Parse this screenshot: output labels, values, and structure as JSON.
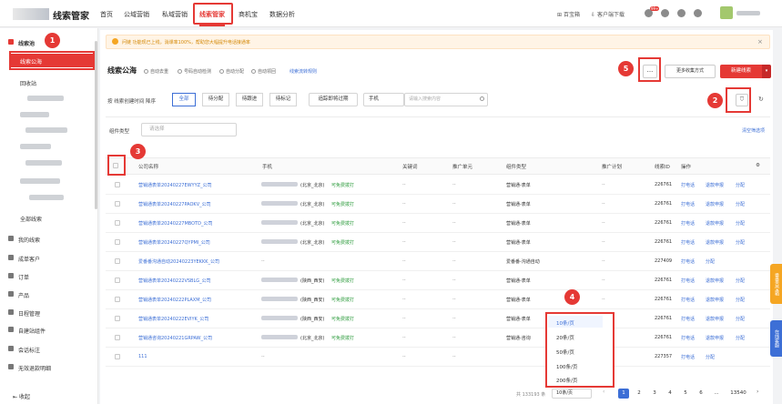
{
  "topnav": {
    "brand": "线索管家",
    "items": [
      "首页",
      "公域营销",
      "私域营销",
      "线索管家",
      "商机宝",
      "数据分析"
    ],
    "tools": [
      "百宝箱",
      "客户端下载"
    ],
    "badge": "99+"
  },
  "sidebar": {
    "group": "线索池",
    "active": "线索公海",
    "items": [
      "回收站",
      "全部线索",
      "我的线索",
      "成单客户",
      "订单",
      "产品",
      "日程管理",
      "自建站组件",
      "会话标注",
      "无效退款明细"
    ],
    "collapse": "收起"
  },
  "markers": [
    "1",
    "2",
    "3",
    "4",
    "5"
  ],
  "banner": {
    "text": "问链 功能现已上线，消课率100%，帮助您大幅提升电话接通率"
  },
  "page": {
    "title": "线索公海",
    "toggles": [
      "自动去重",
      "号码自动检测",
      "自动分配",
      "自动领回"
    ],
    "rule_link": "线索流转规则",
    "more": "...",
    "collect": "更多收集方式",
    "new": "新建线索"
  },
  "filters": {
    "sort_label": "按 线索创建时间 降序",
    "tabs": [
      "全部",
      "待分配",
      "待跟进",
      "待标记"
    ],
    "today": "追踪即将过期",
    "phone": "手机",
    "search_placeholder": "请输入搜索内容",
    "comp_label": "组件类型",
    "comp_placeholder": "请选择",
    "clear": "清空筛选项"
  },
  "table": {
    "headers": [
      "公司名称",
      "手机",
      "关键词",
      "推广单元",
      "组件类型",
      "推广计划",
      "线索ID",
      "操作"
    ],
    "rows": [
      {
        "company": "营销通表单20240227EWYYZ_公司",
        "region": "(北京_北京)",
        "status": "可免费拨打",
        "kw": "--",
        "unit": "--",
        "type": "营销通-表单",
        "plan": "--",
        "id": "226761",
        "ops": [
          "打电话",
          "退款申报",
          "分配"
        ]
      },
      {
        "company": "营销通表单20240227PAOKV_公司",
        "region": "(北京_北京)",
        "status": "可免费拨打",
        "kw": "--",
        "unit": "--",
        "type": "营销通-表单",
        "plan": "--",
        "id": "226761",
        "ops": [
          "打电话",
          "退款申报",
          "分配"
        ]
      },
      {
        "company": "营销通表单20240227MBOTD_公司",
        "region": "(北京_北京)",
        "status": "可免费拨打",
        "kw": "--",
        "unit": "--",
        "type": "营销通-表单",
        "plan": "--",
        "id": "226761",
        "ops": [
          "打电话",
          "退款申报",
          "分配"
        ]
      },
      {
        "company": "营销通表单20240227QYPMI_公司",
        "region": "(北京_北京)",
        "status": "可免费拨打",
        "kw": "--",
        "unit": "--",
        "type": "营销通-表单",
        "plan": "--",
        "id": "226761",
        "ops": [
          "打电话",
          "退款申报",
          "分配"
        ]
      },
      {
        "company": "爱番番沟通自动20240223YEKKK_公司",
        "region": "",
        "status": "",
        "kw": "--",
        "unit": "--",
        "type": "爱番番-沟通自动",
        "plan": "--",
        "id": "227409",
        "ops": [
          "打电话",
          "分配"
        ]
      },
      {
        "company": "营销通表单20240222VSBLG_公司",
        "region": "(陕西_西安)",
        "status": "可免费拨打",
        "kw": "--",
        "unit": "--",
        "type": "营销通-表单",
        "plan": "--",
        "id": "226761",
        "ops": [
          "打电话",
          "退款申报",
          "分配"
        ]
      },
      {
        "company": "营销通表单20240222PLAXM_公司",
        "region": "(陕西_西安)",
        "status": "可免费拨打",
        "kw": "--",
        "unit": "--",
        "type": "营销通-表单",
        "plan": "--",
        "id": "226761",
        "ops": [
          "打电话",
          "退款申报",
          "分配"
        ]
      },
      {
        "company": "营销通表单20240222EVIYK_公司",
        "region": "(陕西_西安)",
        "status": "可免费拨打",
        "kw": "--",
        "unit": "--",
        "type": "营销通-表单",
        "plan": "--",
        "id": "226761",
        "ops": [
          "打电话",
          "退款申报",
          "分配"
        ]
      },
      {
        "company": "营销通咨询20240221GRPAW_公司",
        "region": "(北京_北京)",
        "status": "可免费拨打",
        "kw": "--",
        "unit": "--",
        "type": "营销通-咨询",
        "plan": "--",
        "id": "226761",
        "ops": [
          "打电话",
          "退款申报",
          "分配"
        ]
      },
      {
        "company": "111",
        "region": "",
        "status": "",
        "kw": "--",
        "unit": "--",
        "type": "",
        "plan": "--",
        "id": "227357",
        "ops": [
          "打电话",
          "分配"
        ]
      }
    ]
  },
  "pagination": {
    "total": "共 133193 条",
    "size": "10条/页",
    "options": [
      "10条/页",
      "20条/页",
      "50条/页",
      "100条/页",
      "200条/页"
    ],
    "pages": [
      "1",
      "2",
      "3",
      "4",
      "5",
      "6",
      "...",
      "13540"
    ],
    "current": "1"
  },
  "side_tabs": [
    "番番百宝箱",
    "在线客服"
  ]
}
